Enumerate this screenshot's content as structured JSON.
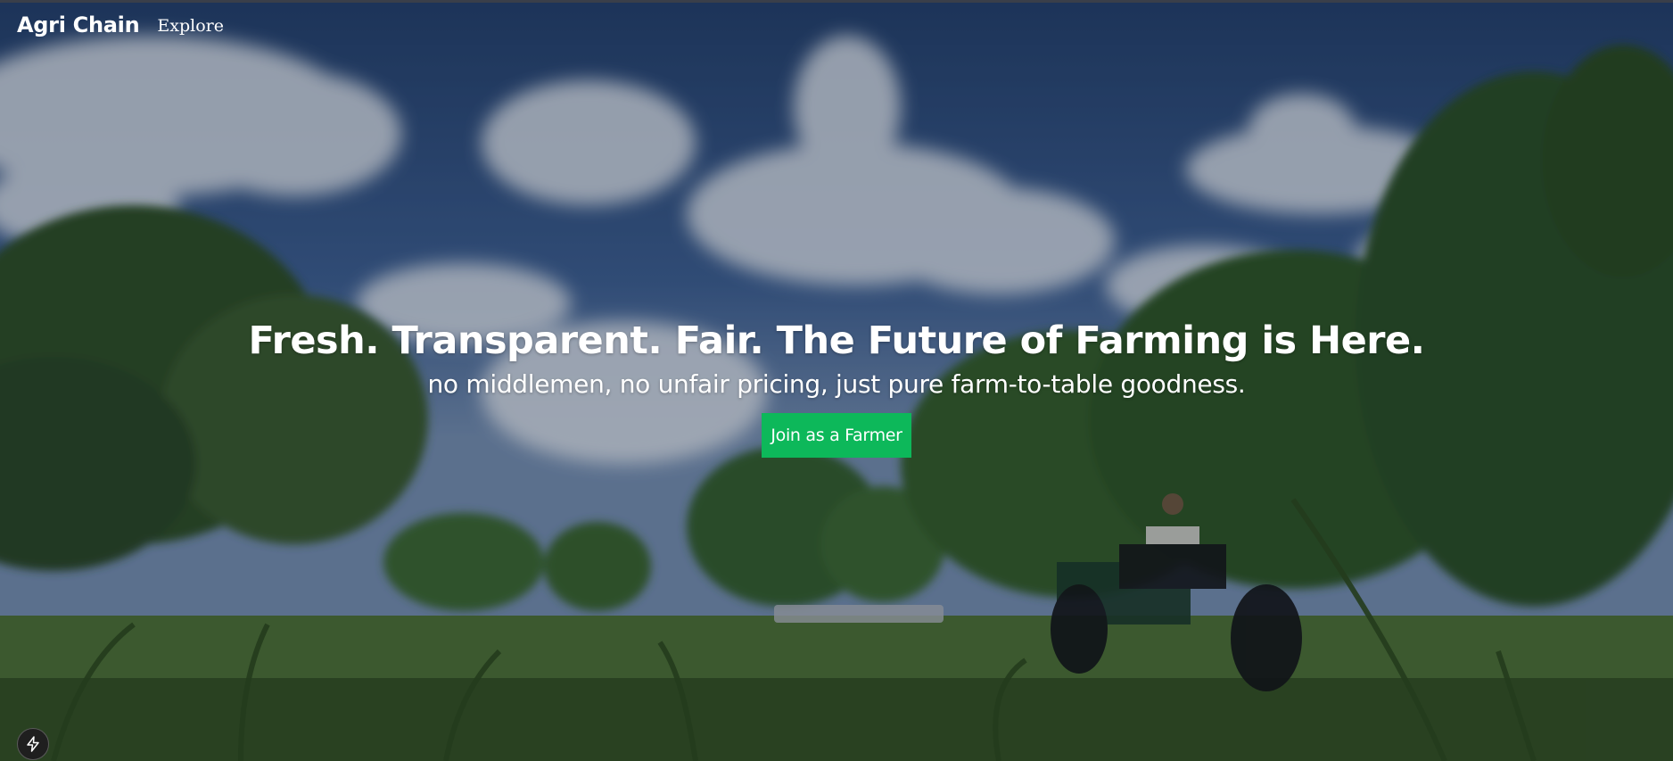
{
  "nav": {
    "brand": "Agri Chain",
    "explore": "Explore"
  },
  "hero": {
    "headline": "Fresh. Transparent. Fair. The Future of Farming is Here.",
    "subheadline": "no middlemen, no unfair pricing, just pure farm-to-table goodness.",
    "cta_label": "Join as a Farmer"
  },
  "dev_badge": {
    "icon": "lightning-bolt-icon"
  },
  "colors": {
    "cta_bg": "#0db85a",
    "text": "#ffffff",
    "badge_bg": "#1f1f1f"
  }
}
